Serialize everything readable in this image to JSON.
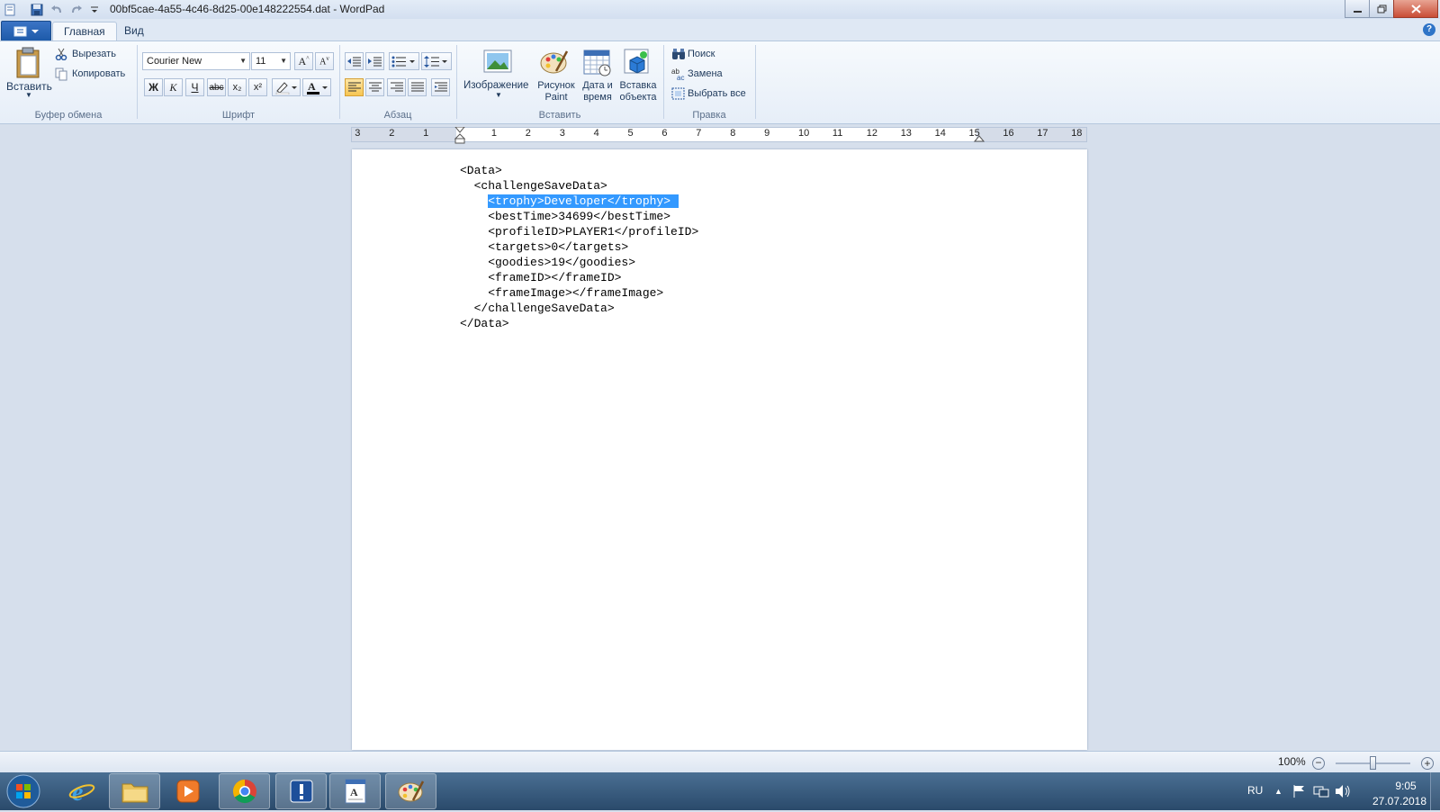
{
  "window": {
    "title": "00bf5cae-4a55-4c46-8d25-00e148222554.dat - WordPad"
  },
  "tabs": {
    "home": "Главная",
    "view": "Вид"
  },
  "clipboard": {
    "paste": "Вставить",
    "cut": "Вырезать",
    "copy": "Копировать",
    "label": "Буфер обмена"
  },
  "font": {
    "family": "Courier New",
    "size": "11",
    "label": "Шрифт",
    "bold": "Ж",
    "italic": "К",
    "underline": "Ч",
    "strike": "abc",
    "sub": "x₂",
    "sup": "x²"
  },
  "paragraph": {
    "label": "Абзац"
  },
  "insert": {
    "image": "Изображение",
    "paint_1": "Рисунок",
    "paint_2": "Paint",
    "datetime_1": "Дата и",
    "datetime_2": "время",
    "object_1": "Вставка",
    "object_2": "объекта",
    "label": "Вставить"
  },
  "editing": {
    "find": "Поиск",
    "replace": "Замена",
    "select_all": "Выбрать все",
    "label": "Правка"
  },
  "ruler": {
    "numbers": [
      "3",
      "2",
      "1",
      "1",
      "2",
      "3",
      "4",
      "5",
      "6",
      "7",
      "8",
      "9",
      "10",
      "11",
      "12",
      "13",
      "14",
      "15",
      "16",
      "17",
      "18"
    ]
  },
  "document": {
    "lines": [
      "<Data>",
      "  <challengeSaveData>",
      "    <trophy>Developer</trophy>",
      "    <bestTime>34699</bestTime>",
      "    <profileID>PLAYER1</profileID>",
      "    <targets>0</targets>",
      "    <goodies>19</goodies>",
      "    <frameID></frameID>",
      "    <frameImage></frameImage>",
      "  </challengeSaveData>",
      "</Data>"
    ]
  },
  "status": {
    "zoom": "100%"
  },
  "tray": {
    "lang": "RU",
    "time": "9:05",
    "date": "27.07.2018"
  }
}
